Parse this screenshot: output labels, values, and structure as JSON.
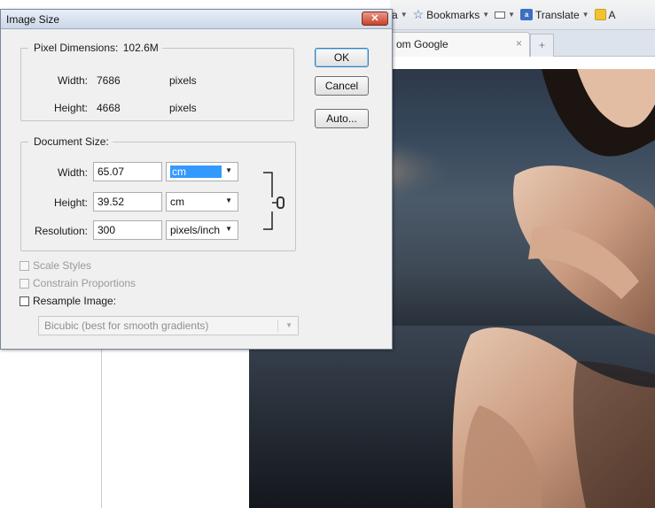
{
  "dialog": {
    "title": "Image Size",
    "close_glyph": "✕",
    "pixel_dimensions": {
      "legend": "Pixel Dimensions:",
      "size": "102.6M",
      "width_label": "Width:",
      "width_value": "7686",
      "width_unit": "pixels",
      "height_label": "Height:",
      "height_value": "4668",
      "height_unit": "pixels"
    },
    "document_size": {
      "legend": "Document Size:",
      "width_label": "Width:",
      "width_value": "65.07",
      "width_unit": "cm",
      "height_label": "Height:",
      "height_value": "39.52",
      "height_unit": "cm",
      "resolution_label": "Resolution:",
      "resolution_value": "300",
      "resolution_unit": "pixels/inch"
    },
    "buttons": {
      "ok": "OK",
      "cancel": "Cancel",
      "auto": "Auto..."
    },
    "options": {
      "scale_styles": "Scale Styles",
      "constrain_proportions": "Constrain Proportions",
      "resample_image": "Resample Image:",
      "resample_method": "Bicubic (best for smooth gradients)"
    }
  },
  "browser": {
    "toolbar": {
      "partial_item": "a",
      "bookmarks": "Bookmarks",
      "translate": "Translate",
      "partial_last": "A"
    },
    "tab": {
      "title": "om Google",
      "close_glyph": "×",
      "new_tab_glyph": "+"
    }
  },
  "icons": [
    "close-icon",
    "bookmark-star-icon",
    "translate-icon",
    "chevron-down-icon",
    "chain-link-icon"
  ],
  "colors": {
    "selection": "#3399ff",
    "close_button": "#c9402a",
    "titlebar": "#cbd7e8"
  }
}
